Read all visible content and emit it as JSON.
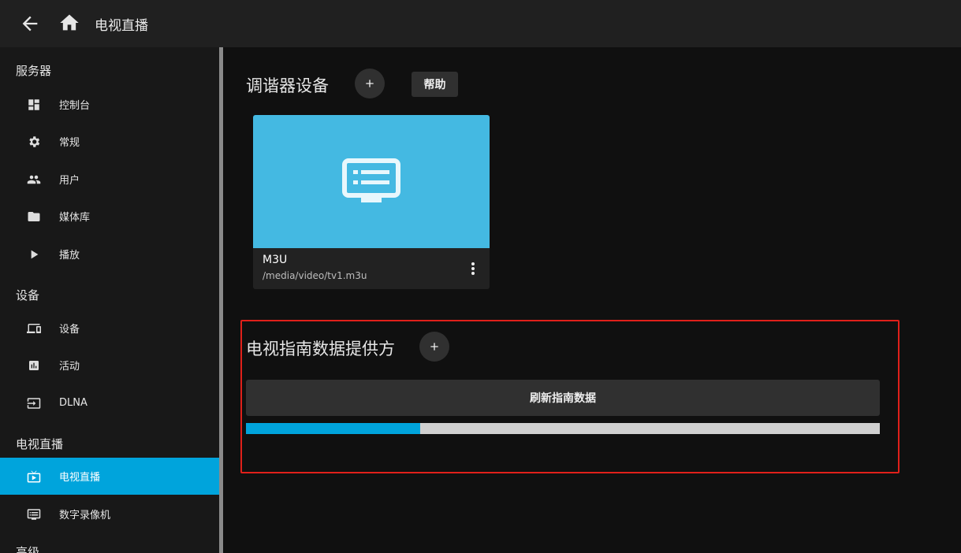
{
  "header": {
    "title": "电视直播"
  },
  "sidebar": {
    "sections": [
      {
        "title": "服务器"
      },
      {
        "title": "设备"
      },
      {
        "title": "电视直播"
      },
      {
        "title": "高级"
      }
    ],
    "items": [
      {
        "label": "控制台",
        "icon": "dashboard-icon"
      },
      {
        "label": "常规",
        "icon": "gear-icon"
      },
      {
        "label": "用户",
        "icon": "users-icon"
      },
      {
        "label": "媒体库",
        "icon": "folder-icon"
      },
      {
        "label": "播放",
        "icon": "play-icon"
      },
      {
        "label": "设备",
        "icon": "devices-icon"
      },
      {
        "label": "活动",
        "icon": "activity-icon"
      },
      {
        "label": "DLNA",
        "icon": "input-icon"
      },
      {
        "label": "电视直播",
        "icon": "live-tv-icon",
        "active": true
      },
      {
        "label": "数字录像机",
        "icon": "dvr-icon"
      }
    ]
  },
  "main": {
    "tuners": {
      "title": "调谐器设备",
      "help_label": "帮助",
      "card": {
        "name": "M3U",
        "path": "/media/video/tv1.m3u"
      }
    },
    "guide": {
      "title": "电视指南数据提供方",
      "refresh_label": "刷新指南数据",
      "progress": 0.275
    }
  },
  "colors": {
    "accent": "#00a4dc",
    "card_image": "#44b9e2",
    "highlight": "#e0201a"
  }
}
